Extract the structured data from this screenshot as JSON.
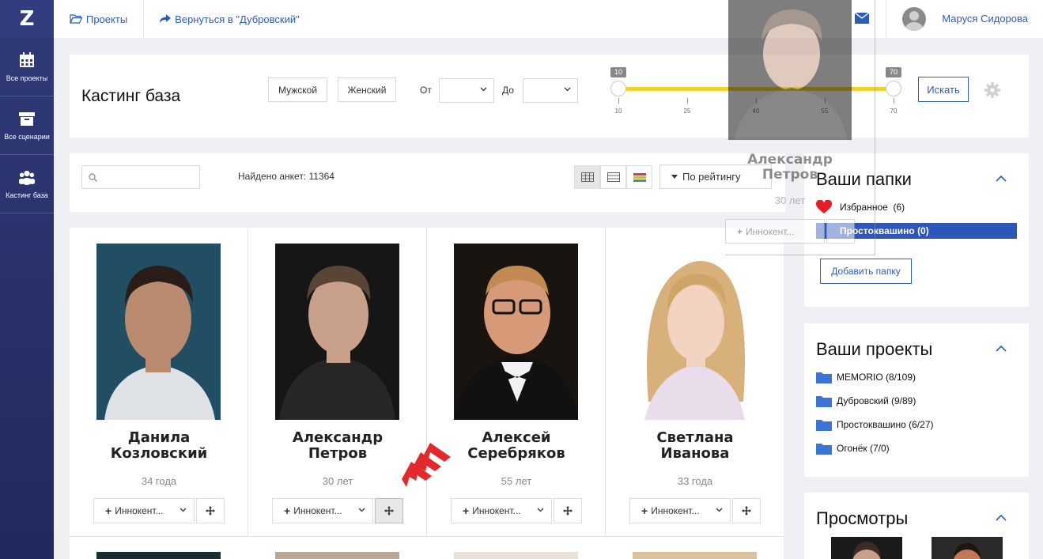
{
  "sidebar": {
    "logo": "Z",
    "items": [
      {
        "label": "Все проекты"
      },
      {
        "label": "Все сценарии"
      },
      {
        "label": "Кастинг база"
      }
    ]
  },
  "topbar": {
    "projects_link": "Проекты",
    "back_link": "Вернуться в \"Дубровский\"",
    "username": "Маруся Сидорова"
  },
  "filter": {
    "title": "Кастинг база",
    "male": "Мужской",
    "female": "Женский",
    "from_label": "От",
    "to_label": "До",
    "range_min": 10,
    "range_max": 70,
    "ticks": [
      "10",
      "25",
      "40",
      "55",
      "70"
    ],
    "search_button": "Искать"
  },
  "toolbar": {
    "search_placeholder": "",
    "found_text": "Найдено анкет: 11364",
    "sort_label": "По рейтингу"
  },
  "cards": [
    {
      "name_line1": "Данила",
      "name_line2": "Козловский",
      "age": "34 года",
      "add_label": "Иннокент..."
    },
    {
      "name_line1": "Александр",
      "name_line2": "Петров",
      "age": "30 лет",
      "add_label": "Иннокент..."
    },
    {
      "name_line1": "Алексей",
      "name_line2": "Серебряков",
      "age": "55 лет",
      "add_label": "Иннокент..."
    },
    {
      "name_line1": "Светлана",
      "name_line2": "Иванова",
      "age": "33 года",
      "add_label": "Иннокент..."
    }
  ],
  "drag_ghost": {
    "name_line1": "Александр",
    "name_line2": "Петров",
    "age": "30 лет",
    "add_label": "Иннокент..."
  },
  "folders": {
    "title": "Ваши папки",
    "items": [
      {
        "label": "Избранное",
        "count": "(6)"
      },
      {
        "label": "Простоквашино",
        "count": "(0)"
      }
    ],
    "add_button": "Добавить папку"
  },
  "projects": {
    "title": "Ваши проекты",
    "items": [
      {
        "label": "MEMORIO (8/109)"
      },
      {
        "label": "Дубровский (9/89)"
      },
      {
        "label": "Простоквашино (6/27)"
      },
      {
        "label": "Огонёк (7/0)"
      }
    ]
  },
  "views": {
    "title": "Просмотры"
  },
  "colors": {
    "accent": "#2c5bb8",
    "sidebar": "#2a3370",
    "slider": "#f0d22a",
    "selected_folder": "#2e55b8",
    "heart": "#e81c24",
    "arrow": "#e32a2a"
  }
}
